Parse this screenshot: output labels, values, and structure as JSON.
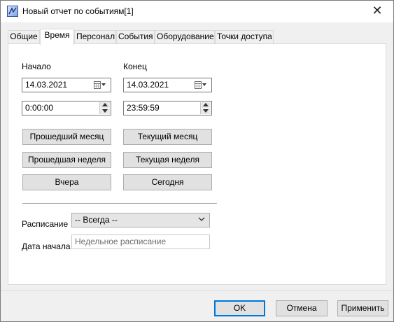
{
  "window": {
    "title": "Новый отчет по событиям[1]",
    "close_symbol": "✕"
  },
  "tabs": [
    {
      "label": "Общие"
    },
    {
      "label": "Время"
    },
    {
      "label": "Персонал"
    },
    {
      "label": "События"
    },
    {
      "label": "Оборудование"
    },
    {
      "label": "Точки доступа"
    }
  ],
  "active_tab": "Время",
  "time": {
    "start_label": "Начало",
    "end_label": "Конец",
    "start_date": "14.03.2021",
    "end_date": "14.03.2021",
    "start_time": "0:00:00",
    "end_time": "23:59:59"
  },
  "quick_buttons": {
    "last_month": "Прошедший месяц",
    "current_month": "Текущий месяц",
    "last_week": "Прошедшая неделя",
    "current_week": "Текущая неделя",
    "yesterday": "Вчера",
    "today": "Сегодня"
  },
  "schedule": {
    "label": "Расписание",
    "value": "-- Всегда --",
    "start_date_label": "Дата начала",
    "start_date_placeholder": "Недельное расписание"
  },
  "footer": {
    "ok": "OK",
    "cancel": "Отмена",
    "apply": "Применить"
  }
}
